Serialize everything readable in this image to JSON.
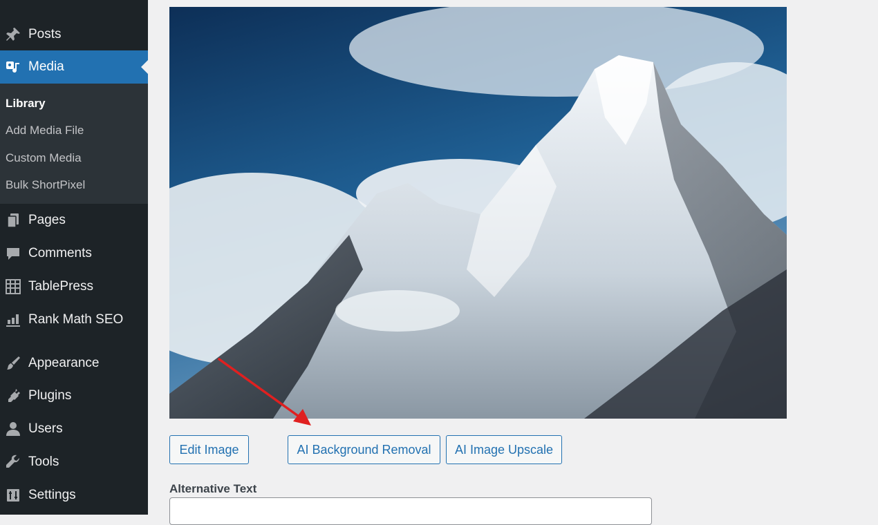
{
  "sidebar": {
    "items_top": [
      {
        "label": "Posts",
        "icon": "pin-icon"
      },
      {
        "label": "Media",
        "icon": "media-icon",
        "active": true
      }
    ],
    "submenu": [
      "Library",
      "Add Media File",
      "Custom Media",
      "Bulk ShortPixel"
    ],
    "items_bottom": [
      {
        "label": "Pages",
        "icon": "pages-icon"
      },
      {
        "label": "Comments",
        "icon": "comment-icon"
      },
      {
        "label": "TablePress",
        "icon": "table-icon"
      },
      {
        "label": "Rank Math SEO",
        "icon": "chart-icon"
      },
      {
        "label": "Appearance",
        "icon": "brush-icon"
      },
      {
        "label": "Plugins",
        "icon": "plug-icon"
      },
      {
        "label": "Users",
        "icon": "user-icon"
      },
      {
        "label": "Tools",
        "icon": "wrench-icon"
      },
      {
        "label": "Settings",
        "icon": "settings-icon"
      }
    ]
  },
  "buttons": {
    "edit_image": "Edit Image",
    "ai_bg_removal": "AI Background Removal",
    "ai_upscale": "AI Image Upscale"
  },
  "fields": {
    "alt_text_label": "Alternative Text",
    "alt_text_value": ""
  },
  "colors": {
    "sidebar_bg": "#1d2327",
    "submenu_bg": "#2c3338",
    "active_bg": "#2271b1",
    "annotation_arrow": "#e02020"
  }
}
